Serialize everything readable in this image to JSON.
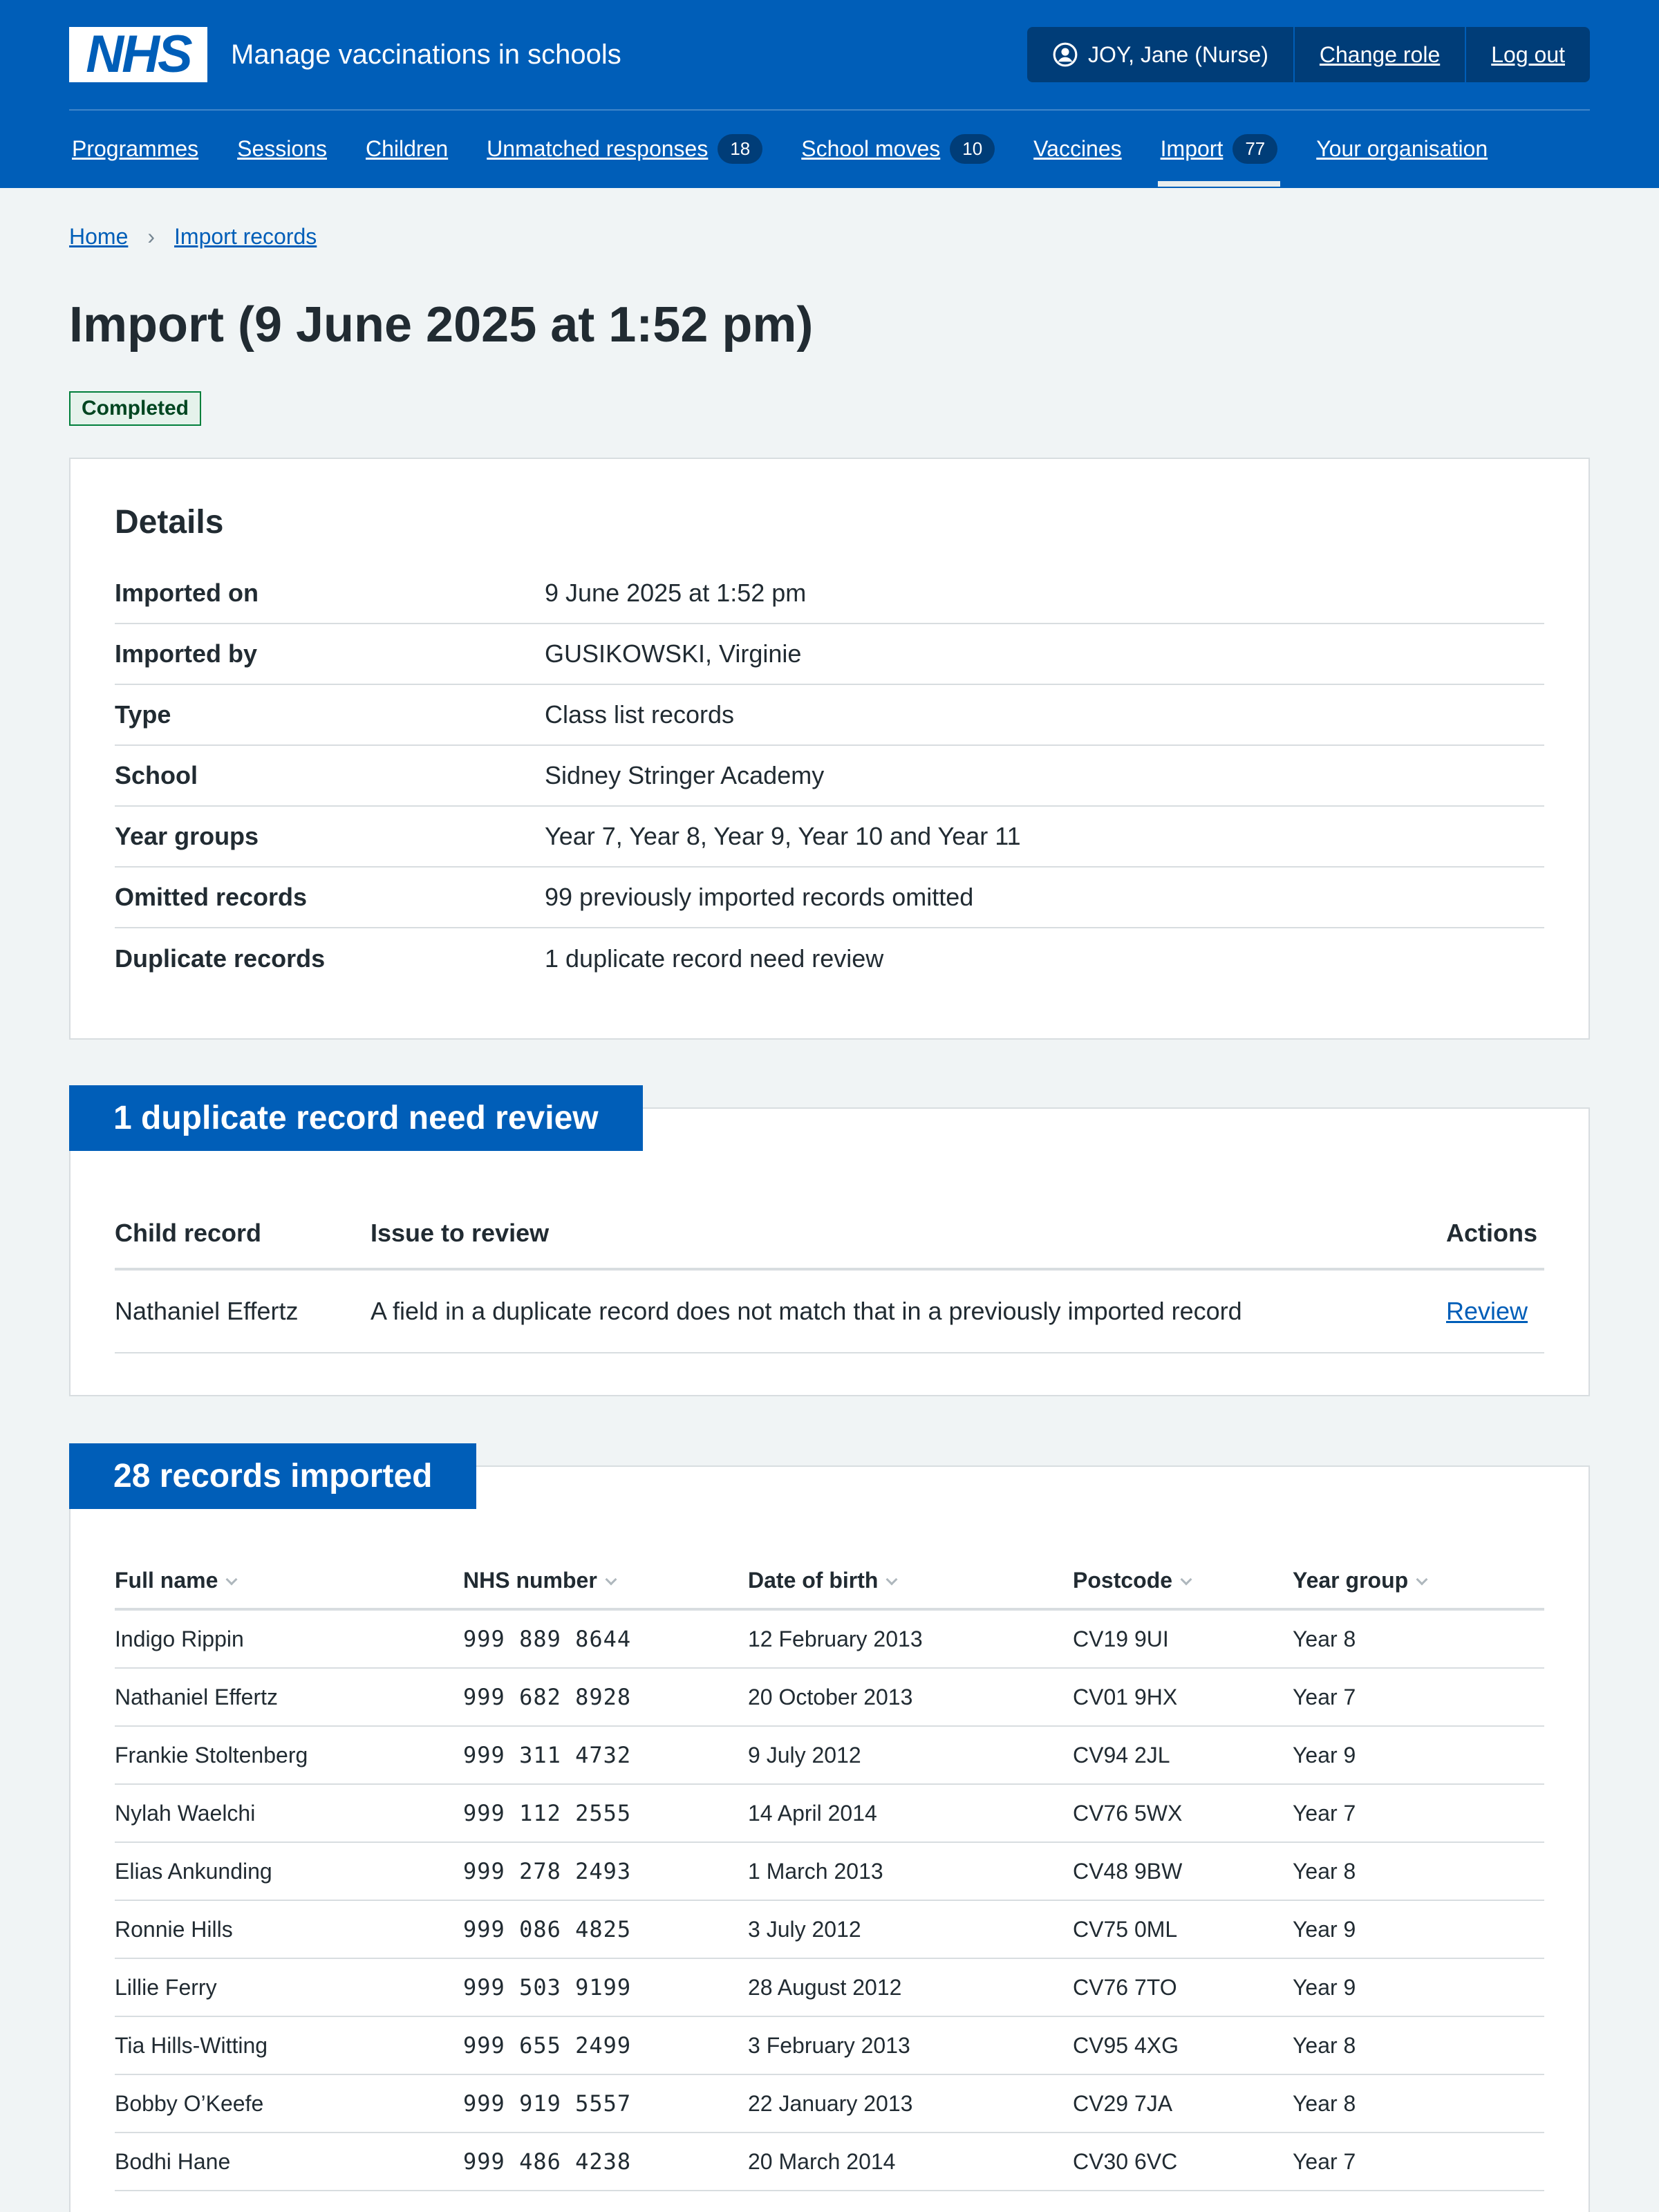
{
  "header": {
    "logo_text": "NHS",
    "service_name": "Manage vaccinations in schools",
    "user": "JOY, Jane (Nurse)",
    "change_role": "Change role",
    "log_out": "Log out"
  },
  "nav": [
    {
      "label": "Programmes"
    },
    {
      "label": "Sessions"
    },
    {
      "label": "Children"
    },
    {
      "label": "Unmatched responses",
      "count": "18"
    },
    {
      "label": "School moves",
      "count": "10"
    },
    {
      "label": "Vaccines"
    },
    {
      "label": "Import",
      "count": "77",
      "active": true
    },
    {
      "label": "Your organisation"
    }
  ],
  "breadcrumb": {
    "home": "Home",
    "import_records": "Import records"
  },
  "page_title": "Import (9 June 2025 at 1:52 pm)",
  "status_tag": "Completed",
  "details": {
    "title": "Details",
    "rows": [
      {
        "key": "Imported on",
        "value": "9 June 2025 at 1:52 pm"
      },
      {
        "key": "Imported by",
        "value": "GUSIKOWSKI, Virginie"
      },
      {
        "key": "Type",
        "value": "Class list records"
      },
      {
        "key": "School",
        "value": "Sidney Stringer Academy"
      },
      {
        "key": "Year groups",
        "value": "Year 7, Year 8, Year 9, Year 10 and Year 11"
      },
      {
        "key": "Omitted records",
        "value": "99 previously imported records omitted"
      },
      {
        "key": "Duplicate records",
        "value": "1 duplicate record need review"
      }
    ]
  },
  "duplicates": {
    "heading": "1 duplicate record need review",
    "columns": {
      "child": "Child record",
      "issue": "Issue to review",
      "actions": "Actions"
    },
    "rows": [
      {
        "child": "Nathaniel Effertz",
        "issue": "A field in a duplicate record does not match that in a previously imported record",
        "action": "Review"
      }
    ]
  },
  "records": {
    "heading": "28 records imported",
    "columns": {
      "name": "Full name",
      "nhs": "NHS number",
      "dob": "Date of birth",
      "postcode": "Postcode",
      "year": "Year group"
    },
    "rows": [
      {
        "name": "Indigo Rippin",
        "nhs": "999 889 8644",
        "dob": "12 February 2013",
        "postcode": "CV19 9UI",
        "year": "Year 8"
      },
      {
        "name": "Nathaniel Effertz",
        "nhs": "999 682 8928",
        "dob": "20 October 2013",
        "postcode": "CV01 9HX",
        "year": "Year 7"
      },
      {
        "name": "Frankie Stoltenberg",
        "nhs": "999 311 4732",
        "dob": "9 July 2012",
        "postcode": "CV94 2JL",
        "year": "Year 9"
      },
      {
        "name": "Nylah Waelchi",
        "nhs": "999 112 2555",
        "dob": "14 April 2014",
        "postcode": "CV76 5WX",
        "year": "Year 7"
      },
      {
        "name": "Elias Ankunding",
        "nhs": "999 278 2493",
        "dob": "1 March 2013",
        "postcode": "CV48 9BW",
        "year": "Year 8"
      },
      {
        "name": "Ronnie Hills",
        "nhs": "999 086 4825",
        "dob": "3 July 2012",
        "postcode": "CV75 0ML",
        "year": "Year 9"
      },
      {
        "name": "Lillie Ferry",
        "nhs": "999 503 9199",
        "dob": "28 August 2012",
        "postcode": "CV76 7TO",
        "year": "Year 9"
      },
      {
        "name": "Tia Hills-Witting",
        "nhs": "999 655 2499",
        "dob": "3 February 2013",
        "postcode": "CV95 4XG",
        "year": "Year 8"
      },
      {
        "name": "Bobby O’Keefe",
        "nhs": "999 919 5557",
        "dob": "22 January 2013",
        "postcode": "CV29 7JA",
        "year": "Year 8"
      },
      {
        "name": "Bodhi Hane",
        "nhs": "999 486 4238",
        "dob": "20 March 2014",
        "postcode": "CV30 6VC",
        "year": "Year 7"
      }
    ]
  }
}
